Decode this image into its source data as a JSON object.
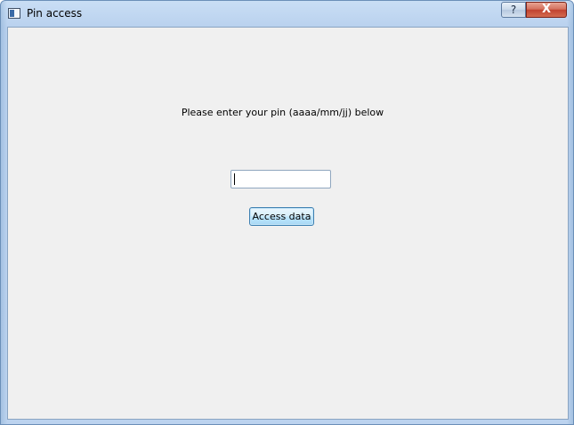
{
  "window": {
    "title": "Pin access",
    "help_button_label": "?",
    "close_button_label": "X"
  },
  "form": {
    "prompt": "Please enter your pin (aaaa/mm/jj) below",
    "pin_value": "",
    "submit_label": "Access data"
  },
  "icons": {
    "app": "application-window-icon",
    "help": "help-icon",
    "close": "close-icon"
  },
  "colors": {
    "titlebar": "#c9def5",
    "client_background": "#f0f0f0",
    "close_button": "#c14330",
    "button_border_focus": "#3c7fb1"
  }
}
